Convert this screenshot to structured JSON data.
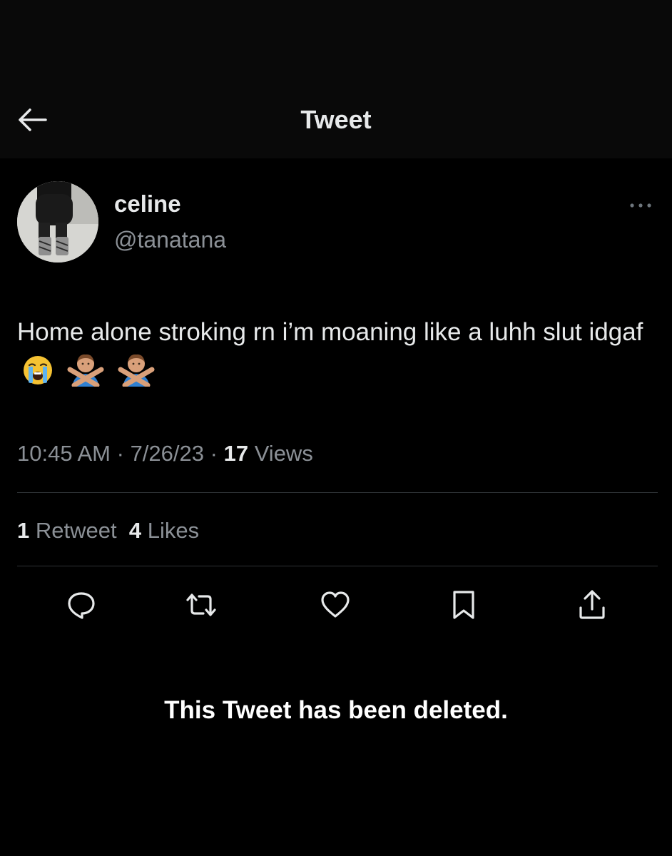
{
  "header": {
    "title": "Tweet",
    "back_icon": "arrow-left-icon"
  },
  "tweet": {
    "author": {
      "display_name": "celine",
      "handle": "@tanatana"
    },
    "more_icon": "ellipsis-icon",
    "text": "Home alone stroking rn i’m moaning like a luhh slut idgaf",
    "emojis": [
      "loudly-crying-face-emoji",
      "person-gesturing-no-emoji",
      "person-gesturing-no-emoji"
    ],
    "time": "10:45 AM",
    "date": "7/26/23",
    "separator": "·",
    "views_count": "17",
    "views_label": "Views",
    "retweets_count": "1",
    "retweets_label": "Retweet",
    "likes_count": "4",
    "likes_label": "Likes"
  },
  "actions": [
    "reply-icon",
    "retweet-icon",
    "like-icon",
    "bookmark-icon",
    "share-icon"
  ],
  "notice": "This Tweet has been deleted.",
  "colors": {
    "background": "#000000",
    "header_background": "#090909",
    "primary_text": "#e7e9ea",
    "secondary_text": "#8b9096",
    "divider": "#2f3336"
  }
}
